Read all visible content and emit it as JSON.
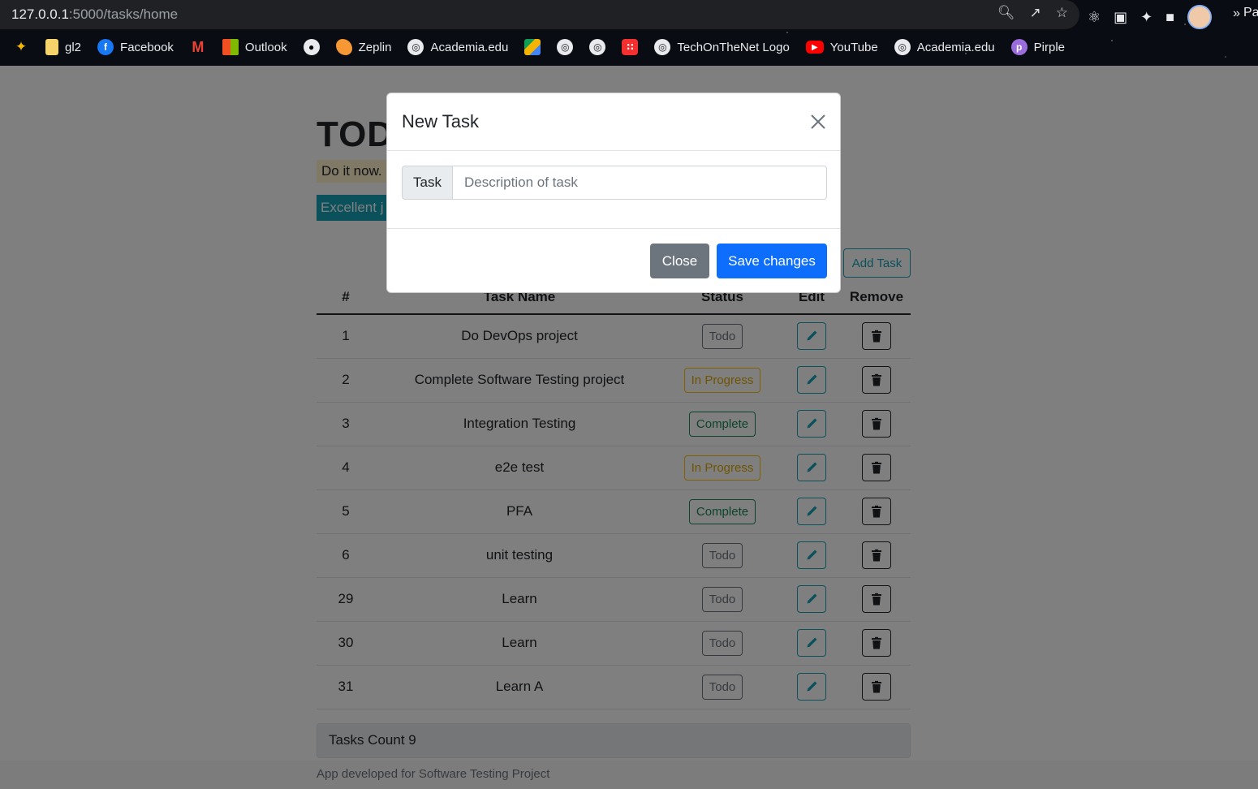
{
  "browser": {
    "url_host": "127.0.0.1",
    "url_rest": ":5000/tasks/home",
    "profile_label": "Pa",
    "bookmarks": [
      {
        "label": "",
        "icon": "pinwheel-icon"
      },
      {
        "label": "gl2",
        "icon": "folder-icon"
      },
      {
        "label": "Facebook",
        "icon": "facebook-icon"
      },
      {
        "label": "",
        "icon": "gmail-icon"
      },
      {
        "label": "Outlook",
        "icon": "microsoft-icon"
      },
      {
        "label": "",
        "icon": "github-icon"
      },
      {
        "label": "Zeplin",
        "icon": "zeplin-icon"
      },
      {
        "label": "Academia.edu",
        "icon": "globe-icon"
      },
      {
        "label": "",
        "icon": "drive-icon"
      },
      {
        "label": "",
        "icon": "globe-icon"
      },
      {
        "label": "",
        "icon": "globe-icon"
      },
      {
        "label": "",
        "icon": "red-grid-icon"
      },
      {
        "label": "TechOnTheNet Logo",
        "icon": "globe-icon"
      },
      {
        "label": "YouTube",
        "icon": "youtube-icon"
      },
      {
        "label": "Academia.edu",
        "icon": "globe-icon"
      },
      {
        "label": "Pirple",
        "icon": "pirple-icon"
      }
    ],
    "more": "»"
  },
  "page": {
    "title": "TOD",
    "subtitle": "Do it now.",
    "alert": "Excellent j",
    "add_task_label": "Add Task",
    "columns": [
      "#",
      "Task Name",
      "Status",
      "Edit",
      "Remove"
    ],
    "tasks": [
      {
        "id": "1",
        "name": "Do DevOps project",
        "status": "Todo"
      },
      {
        "id": "2",
        "name": "Complete Software Testing project",
        "status": "In Progress"
      },
      {
        "id": "3",
        "name": "Integration Testing",
        "status": "Complete"
      },
      {
        "id": "4",
        "name": "e2e test",
        "status": "In Progress"
      },
      {
        "id": "5",
        "name": "PFA",
        "status": "Complete"
      },
      {
        "id": "6",
        "name": "unit testing",
        "status": "Todo"
      },
      {
        "id": "29",
        "name": "Learn",
        "status": "Todo"
      },
      {
        "id": "30",
        "name": "Learn",
        "status": "Todo"
      },
      {
        "id": "31",
        "name": "Learn A",
        "status": "Todo"
      }
    ],
    "count_label": "Tasks Count 9",
    "footer": "App developed for Software Testing Project"
  },
  "modal": {
    "title": "New Task",
    "input_label": "Task",
    "input_placeholder": "Description of task",
    "input_value": "",
    "close_label": "Close",
    "save_label": "Save changes"
  },
  "colors": {
    "primary": "#0d6efd",
    "secondary": "#6c757d",
    "info": "#17a2b8",
    "warning": "#ffc107",
    "success": "#198754"
  }
}
